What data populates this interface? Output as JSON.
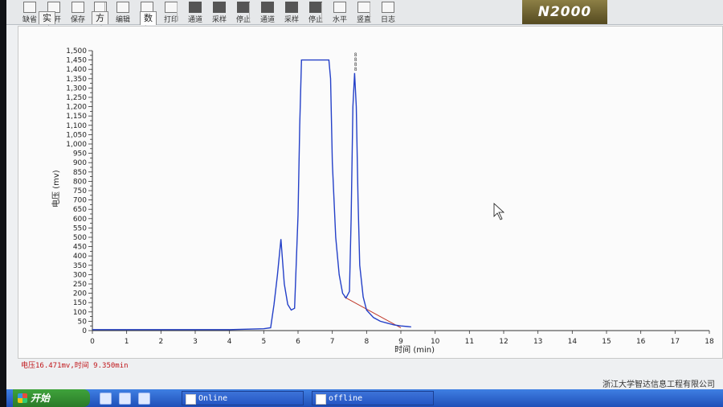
{
  "toolbar": {
    "items": [
      "缺省",
      "打开",
      "保存",
      "另存",
      "编辑",
      "预览",
      "打印",
      "通道",
      "采样",
      "停止",
      "通道",
      "采样",
      "停止",
      "水平",
      "竖直",
      "日志"
    ],
    "logo": "N2000"
  },
  "tabs": [
    "实验信息",
    "方法",
    "数据采集"
  ],
  "status_text": "电压16.471mv,时间 9.350min",
  "company": "浙江大学智达信息工程有限公司",
  "taskbar": {
    "start_label": "开始",
    "tasks": [
      "Online",
      "offline"
    ]
  },
  "chart_data": {
    "type": "line",
    "xlabel": "时间 (min)",
    "ylabel": "电压 (mv)",
    "xlim": [
      0,
      18
    ],
    "ylim": [
      0,
      1500
    ],
    "x_ticks": [
      0,
      1,
      2,
      3,
      4,
      5,
      6,
      7,
      8,
      9,
      10,
      11,
      12,
      13,
      14,
      15,
      16,
      17,
      18
    ],
    "y_ticks": [
      0,
      25,
      50,
      75,
      100,
      125,
      150,
      175,
      200,
      225,
      250,
      275,
      300,
      325,
      350,
      375,
      400,
      425,
      450,
      475,
      500,
      525,
      550,
      575,
      600,
      625,
      650,
      675,
      700,
      725,
      750,
      775,
      800,
      825,
      850,
      875,
      900,
      925,
      950,
      975,
      1000,
      1025,
      1050,
      1075,
      1100,
      1125,
      1150,
      1175,
      1200,
      1225,
      1250,
      1275,
      1300,
      1325,
      1350,
      1375,
      1400,
      1425,
      1450,
      1475,
      1500
    ],
    "y_tick_labels": [
      "0",
      "50",
      "100",
      "150",
      "200",
      "250",
      "300",
      "350",
      "400",
      "450",
      "500",
      "550",
      "600",
      "650",
      "700",
      "750",
      "800",
      "850",
      "900",
      "950",
      "1,000",
      "1,050",
      "1,100",
      "1,150",
      "1,200",
      "1,250",
      "1,300",
      "1,350",
      "1,400",
      "1,450",
      "1,500"
    ],
    "series": [
      {
        "color": "#2440c8",
        "x": [
          0,
          1,
          2,
          3,
          4,
          5,
          5.2,
          5.3,
          5.4,
          5.5,
          5.6,
          5.7,
          5.8,
          5.9,
          6.0,
          6.05,
          6.1,
          6.2,
          6.5,
          6.9,
          6.95,
          7.0,
          7.1,
          7.2,
          7.3,
          7.4,
          7.5,
          7.55,
          7.6,
          7.65,
          7.7,
          7.75,
          7.8,
          7.9,
          8.0,
          8.2,
          8.4,
          8.6,
          8.8,
          9.0,
          9.3
        ],
        "y": [
          5,
          5,
          5,
          5,
          5,
          10,
          15,
          140,
          300,
          490,
          250,
          140,
          110,
          120,
          620,
          1100,
          1450,
          1450,
          1450,
          1450,
          1350,
          900,
          500,
          300,
          200,
          175,
          210,
          600,
          1200,
          1380,
          1200,
          700,
          350,
          180,
          110,
          70,
          50,
          40,
          30,
          25,
          20
        ]
      }
    ],
    "baseline": {
      "color": "#c0392b",
      "x": [
        7.35,
        9.0
      ],
      "y": [
        180,
        15
      ]
    },
    "peak_marker": {
      "x": 7.68,
      "labels": [
        "8",
        "8",
        "8",
        "8"
      ]
    }
  }
}
